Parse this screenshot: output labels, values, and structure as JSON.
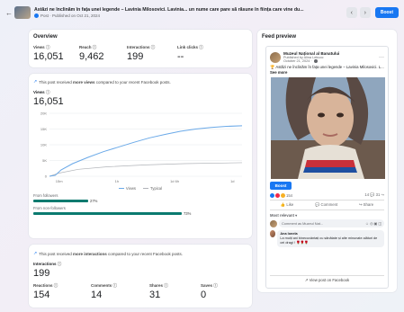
{
  "header": {
    "title": "Astăzi ne înclinăm în fața unei legende – Lavinia Milosovici. Lavinia... un nume care pare să răsune în ființa care vine du...",
    "subtitle": "Post · Published on Oct 21, 2024",
    "boost_label": "Boost",
    "prev_icon": "chevron-left-icon",
    "next_icon": "chevron-right-icon"
  },
  "overview": {
    "title": "Overview",
    "metrics": [
      {
        "label": "Views",
        "value": "16,051"
      },
      {
        "label": "Reach",
        "value": "9,462"
      },
      {
        "label": "Interactions",
        "value": "199"
      },
      {
        "label": "Link clicks",
        "value": "--"
      }
    ]
  },
  "views_card": {
    "note_prefix": "This post received ",
    "note_bold": "more views",
    "note_suffix": " compared to your recent Facebook posts.",
    "label": "Views",
    "value": "16,051",
    "legend_views": "Views",
    "legend_typical": "Typical",
    "followers_label": "From followers",
    "followers_pct": "27%",
    "followers_frac": 0.27,
    "nonfollowers_label": "From non-followers",
    "nonfollowers_pct": "73%",
    "nonfollowers_frac": 0.73
  },
  "chart_data": {
    "type": "line",
    "x": [
      "15m",
      "1h",
      "1d 6h",
      "1d"
    ],
    "yticks": [
      "0",
      "5K",
      "10K",
      "15K",
      "20K"
    ],
    "ylim": [
      0,
      20000
    ],
    "series": [
      {
        "name": "Views",
        "color": "#6aa9e8",
        "values": [
          [
            0,
            0
          ],
          [
            0.03,
            300
          ],
          [
            0.06,
            2000
          ],
          [
            0.12,
            4000
          ],
          [
            0.2,
            6000
          ],
          [
            0.28,
            7800
          ],
          [
            0.36,
            9300
          ],
          [
            0.44,
            10800
          ],
          [
            0.52,
            12200
          ],
          [
            0.6,
            13300
          ],
          [
            0.68,
            14300
          ],
          [
            0.76,
            15000
          ],
          [
            0.84,
            15500
          ],
          [
            0.92,
            15850
          ],
          [
            1.0,
            16051
          ]
        ]
      },
      {
        "name": "Typical",
        "color": "#b0b3b8",
        "values": [
          [
            0,
            0
          ],
          [
            0.05,
            1000
          ],
          [
            0.15,
            2200
          ],
          [
            0.3,
            3000
          ],
          [
            0.5,
            3600
          ],
          [
            0.7,
            4000
          ],
          [
            1.0,
            4300
          ]
        ]
      }
    ]
  },
  "interactions_card": {
    "note_prefix": "This post received ",
    "note_bold": "more interactions",
    "note_suffix": " compared to your recent Facebook posts.",
    "label": "Interactions",
    "value": "199",
    "metrics": [
      {
        "label": "Reactions",
        "value": "154"
      },
      {
        "label": "Comments",
        "value": "14"
      },
      {
        "label": "Shares",
        "value": "31"
      },
      {
        "label": "Saves",
        "value": "0"
      }
    ]
  },
  "feed": {
    "title": "Feed preview",
    "page_name": "Muzeul Național al Banatului",
    "published_by": "Published by Alina Lebuoc",
    "date": "October 21, 2024 ·",
    "text": "Astăzi ne înclinăm în fața unei legende – Lavinia Milosovici. L...",
    "see_more": "See more",
    "boost_label": "Boost",
    "reactions_count": "154",
    "comments_count": "14",
    "shares_count": "31",
    "like_label": "Like",
    "comment_label": "Comment",
    "share_label": "Share",
    "most_relevant": "Most relevant",
    "comment_placeholder": "Comment as Muzeul Nat...",
    "commenter_name": "Ana Ionela",
    "comment_text": "La mulți ani binecuvântați cu sănătate și alte minunate alături de cei dragi !",
    "view_on_fb": "View post on Facebook"
  },
  "colors": {
    "accent": "#1877f2",
    "bar": "#0b7a6f"
  }
}
